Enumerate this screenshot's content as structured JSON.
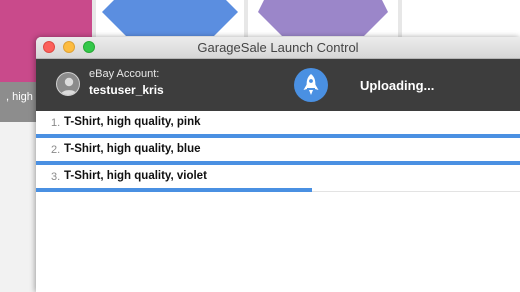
{
  "background": {
    "label_fragment": ", high c"
  },
  "window": {
    "title": "GarageSale Launch Control"
  },
  "header": {
    "account_label": "eBay Account:",
    "account_user": "testuser_kris",
    "status": "Uploading..."
  },
  "items": [
    {
      "number": "1.",
      "name": "T-Shirt, high quality, pink",
      "progress": 1.0
    },
    {
      "number": "2.",
      "name": "T-Shirt, high quality, blue",
      "progress": 1.0
    },
    {
      "number": "3.",
      "name": "T-Shirt, high quality, violet",
      "progress": 0.57
    }
  ],
  "colors": {
    "accent": "#4a90e2",
    "header_bg": "#3d3d3d",
    "pink": "#c94a8b",
    "blue": "#5b8ee0",
    "violet": "#9b86c9"
  },
  "icons": [
    "user-avatar-icon",
    "rocket-icon",
    "close-icon",
    "minimize-icon",
    "maximize-icon"
  ]
}
